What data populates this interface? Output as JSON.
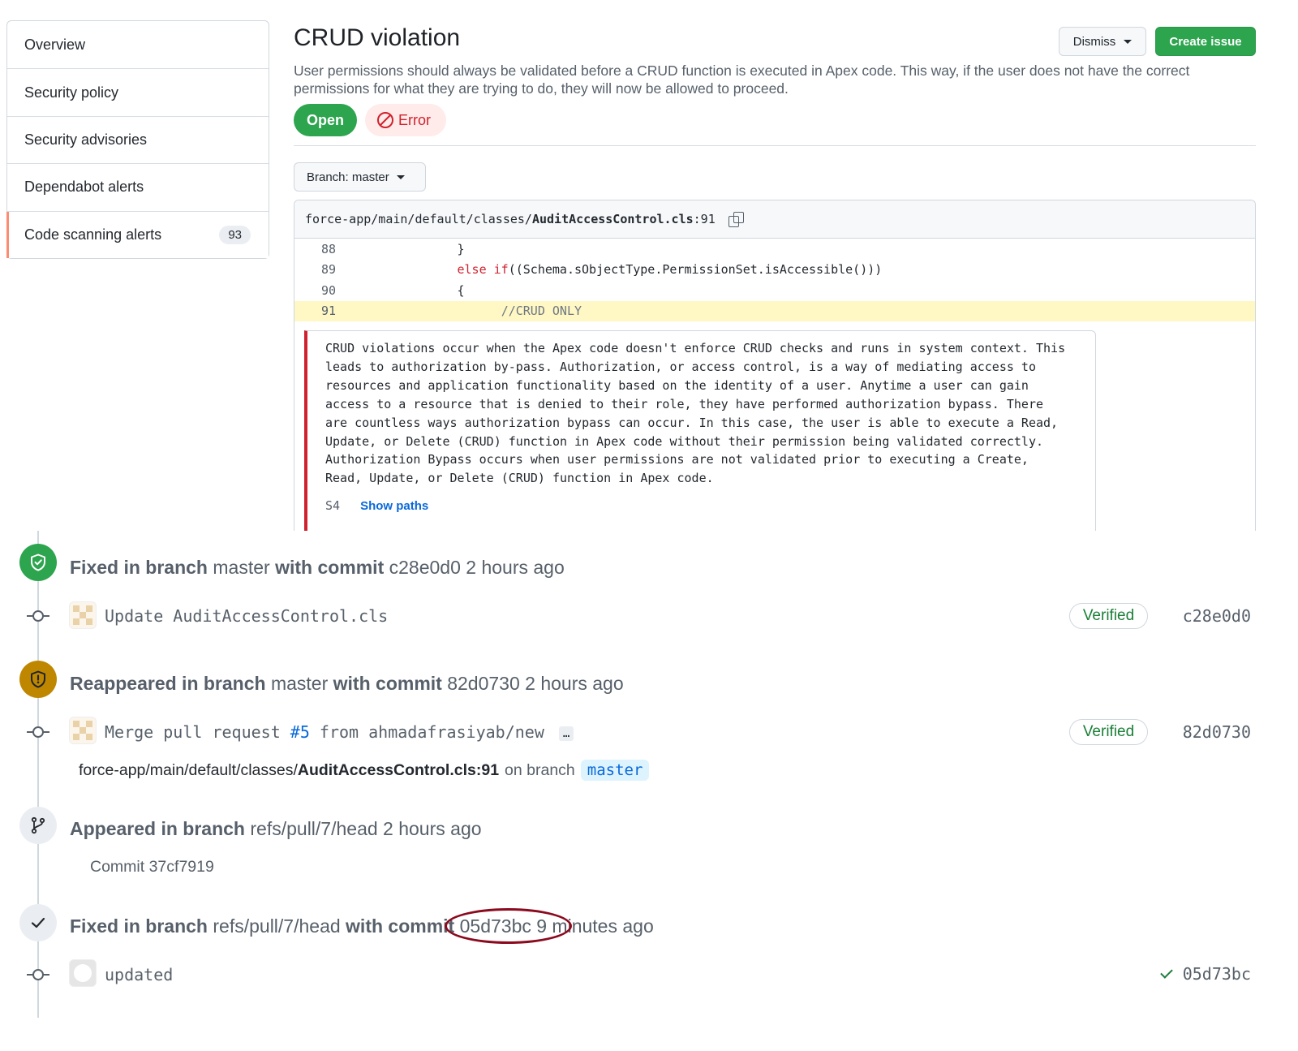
{
  "sidebar": {
    "items": [
      {
        "label": "Overview"
      },
      {
        "label": "Security policy"
      },
      {
        "label": "Security advisories"
      },
      {
        "label": "Dependabot alerts"
      },
      {
        "label": "Code scanning alerts",
        "count": "93"
      }
    ]
  },
  "alert": {
    "title": "CRUD violation",
    "description": "User permissions should always be validated before a CRUD function is executed in Apex code. This way, if the user does not have the correct permissions for what they are trying to do, they will now be allowed to proceed.",
    "dismiss_label": "Dismiss",
    "create_issue_label": "Create issue",
    "status_label": "Open",
    "severity_label": "Error"
  },
  "branch_selector": {
    "prefix": "Branch:",
    "value": "master"
  },
  "code": {
    "path_prefix": "force-app/main/default/classes/",
    "file": "AuditAccessControl.cls",
    "line_suffix": ":91",
    "lines": [
      {
        "num": "88",
        "text": "                }"
      },
      {
        "num": "89",
        "kw": "else if",
        "text": "((Schema.sObjectType.PermissionSet.isAccessible()))"
      },
      {
        "num": "90",
        "text": "                {"
      },
      {
        "num": "91",
        "comment": "//CRUD ONLY"
      }
    ],
    "message": "CRUD violations occur when the Apex code doesn't enforce CRUD checks and runs in system context. This\nleads to authorization by-pass. Authorization, or access control, is a way of mediating access to\nresources and application functionality based on the identity of a user. Anytime a user can gain\naccess to a resource that is denied to their role, they have performed authorization bypass. There\nare countless ways authorization bypass can occur. In this case, the user is able to execute a Read,\nUpdate, or Delete (CRUD) function in Apex code without their permission being validated correctly.\nAuthorization Bypass occurs when user permissions are not validated prior to executing a Create,\nRead, Update, or Delete (CRUD) function in Apex code.",
    "rule_tag": "S4",
    "show_paths_label": "Show paths"
  },
  "timeline": {
    "events": [
      {
        "kind": "fixed",
        "action": "Fixed in branch",
        "branch": "master",
        "with_commit": "with commit",
        "sha": "c28e0d0",
        "time": "2 hours ago",
        "commit_msg": "Update AuditAccessControl.cls",
        "verified": "Verified",
        "commit_sha": "c28e0d0"
      },
      {
        "kind": "reappeared",
        "action": "Reappeared in branch",
        "branch": "master",
        "with_commit": "with commit",
        "sha": "82d0730",
        "time": "2 hours ago",
        "commit_msg_a": "Merge pull request ",
        "issue_ref": "#5",
        "commit_msg_b": " from ahmadafrasiyab/new",
        "ellipsis": "…",
        "verified": "Verified",
        "commit_sha": "82d0730",
        "loc_prefix": "force-app/main/default/classes/",
        "loc_file": "AuditAccessControl.cls:91",
        "loc_on": "on branch",
        "loc_branch": "master"
      },
      {
        "kind": "appeared",
        "action": "Appeared in branch",
        "branch": "refs/pull/7/head",
        "time": "2 hours ago",
        "commit_label": "Commit 37cf7919"
      },
      {
        "kind": "fixed2",
        "action": "Fixed in branch",
        "branch": "refs/pull/7/head",
        "with_commit": "with commit",
        "sha": "05d73bc",
        "time": "9 minutes ago",
        "commit_msg": "updated",
        "commit_sha": "05d73bc"
      }
    ]
  },
  "icons": {
    "fixed": "shield-check-icon",
    "reappeared": "shield-alert-icon",
    "appeared": "git-branch-icon",
    "fixed2": "check-icon",
    "commit": "git-commit-icon",
    "copy": "copy-icon"
  },
  "colors": {
    "open": "#2da44e",
    "error": "#cf222e",
    "reappeared": "#bf8700",
    "verified": "#1a7f37",
    "annotation": "#8b0a1e"
  }
}
